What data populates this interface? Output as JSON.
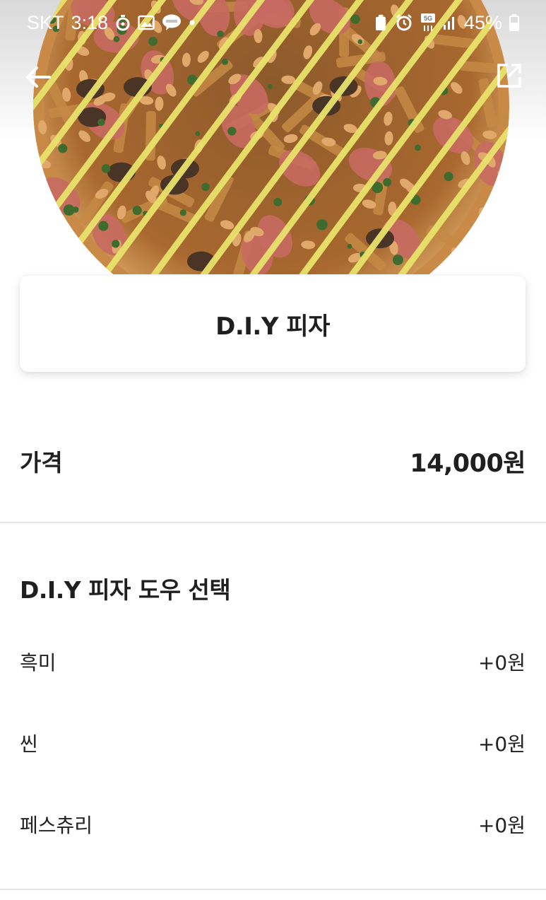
{
  "status_bar": {
    "carrier": "SKT",
    "time": "3:18",
    "network": "5G",
    "battery": "45%"
  },
  "nav": {
    "back_icon": "arrow-left-icon",
    "share_icon": "share-icon"
  },
  "product": {
    "title": "D.I.Y 피자",
    "price_label": "가격",
    "price_value": "14,000원"
  },
  "option_group": {
    "title": "D.I.Y 피자 도우 선택",
    "options": [
      {
        "name": "흑미",
        "price": "+0원"
      },
      {
        "name": "씬",
        "price": "+0원"
      },
      {
        "name": "페스츄리",
        "price": "+0원"
      }
    ]
  },
  "colors": {
    "crust": "#b9753a",
    "topping_base": "#a8682f",
    "mayo": "#e9e36c",
    "ham": "#c86a62",
    "herb": "#3f6b2e"
  }
}
